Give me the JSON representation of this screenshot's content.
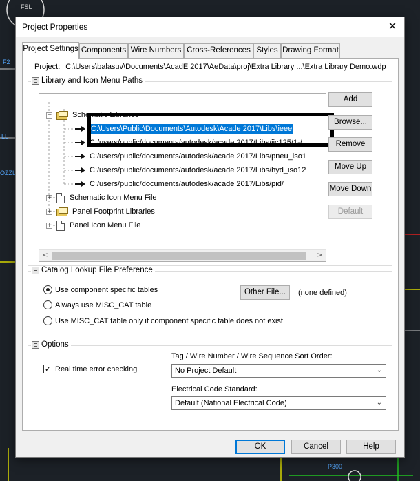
{
  "background": {
    "label_fsl": "FSL",
    "label_f2": "F2",
    "label_ll": "LL",
    "label_ozzle": "OZZLE",
    "label_p300": "P300"
  },
  "dialog": {
    "title": "Project Properties",
    "close_icon": "close-icon"
  },
  "tabs": [
    {
      "label": "Project Settings",
      "active": true
    },
    {
      "label": "Components",
      "active": false
    },
    {
      "label": "Wire Numbers",
      "active": false
    },
    {
      "label": "Cross-References",
      "active": false
    },
    {
      "label": "Styles",
      "active": false
    },
    {
      "label": "Drawing Format",
      "active": false
    }
  ],
  "project": {
    "label": "Project:",
    "path": "C:\\Users\\balasuv\\Documents\\AcadE 2017\\AeData\\proj\\Extra Library ...\\Extra Library Demo.wdp"
  },
  "library_group": {
    "title": "Library and Icon Menu Paths",
    "tree": {
      "schematic_libraries": {
        "label": "Schematic Libraries",
        "expanded": true,
        "paths": [
          "C:\\Users\\Public\\Documents\\Autodesk\\Acade 2017\\Libs\\ieee",
          "C:/users/public/documents/autodesk/acade 2017/Libs/jic125/1-/",
          "C:/users/public/documents/autodesk/acade 2017/Libs/pneu_iso1",
          "C:/users/public/documents/autodesk/acade 2017/Libs/hyd_iso12",
          "C:/users/public/documents/autodesk/acade 2017/Libs/pid/"
        ]
      },
      "schematic_icon_menu": "Schematic Icon Menu File",
      "panel_footprint": "Panel Footprint Libraries",
      "panel_icon_menu": "Panel Icon Menu File"
    },
    "buttons": {
      "add": "Add",
      "browse": "Browse...",
      "remove": "Remove",
      "move_up": "Move Up",
      "move_down": "Move Down",
      "default": "Default"
    }
  },
  "catalog_group": {
    "title": "Catalog Lookup File Preference",
    "options": [
      {
        "label": "Use component specific tables",
        "selected": true
      },
      {
        "label": "Always use MISC_CAT table",
        "selected": false
      },
      {
        "label": "Use MISC_CAT table only if component specific table does not exist",
        "selected": false
      }
    ],
    "other_file_button": "Other File...",
    "other_file_value": "(none defined)"
  },
  "options_group": {
    "title": "Options",
    "realtime_label": "Real time error checking",
    "realtime_checked": true,
    "sort_label": "Tag / Wire Number / Wire Sequence Sort Order:",
    "sort_value": "No Project Default",
    "standard_label": "Electrical Code Standard:",
    "standard_value": "Default (National Electrical Code)"
  },
  "footer": {
    "ok": "OK",
    "cancel": "Cancel",
    "help": "Help"
  }
}
